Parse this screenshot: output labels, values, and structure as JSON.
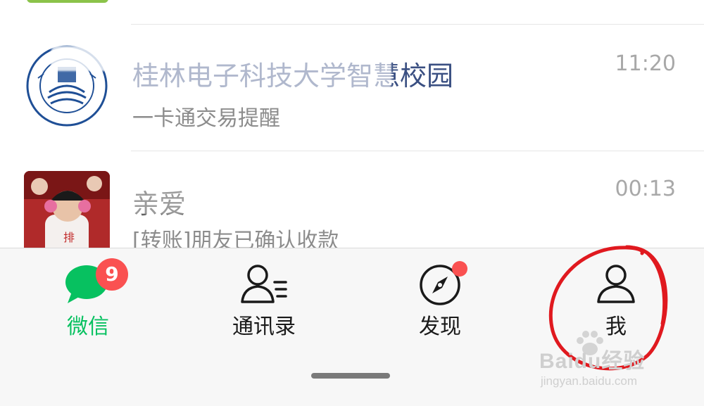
{
  "chats": [
    {
      "title": "桂林电子科技大学智慧校园",
      "preview": "一卡通交易提醒",
      "time": "11:20",
      "avatar": "university-logo"
    },
    {
      "title": "亲爱",
      "preview": "[转账]朋友已确认收款",
      "time": "00:13",
      "avatar": "child-photo"
    }
  ],
  "tabs": [
    {
      "label": "微信",
      "icon": "chat-bubble-icon",
      "badge": "9",
      "active": true
    },
    {
      "label": "通讯录",
      "icon": "contacts-icon",
      "badge": "",
      "active": false
    },
    {
      "label": "发现",
      "icon": "compass-icon",
      "badge": "",
      "active": false,
      "dot": true
    },
    {
      "label": "我",
      "icon": "person-icon",
      "badge": "",
      "active": false
    }
  ],
  "colors": {
    "active": "#07c160",
    "badge": "#fa5151",
    "title_link": "#3a4f82",
    "annotation": "#e0191f"
  },
  "watermark": {
    "main": "Baidu经验",
    "sub": "jingyan.baidu.com"
  }
}
